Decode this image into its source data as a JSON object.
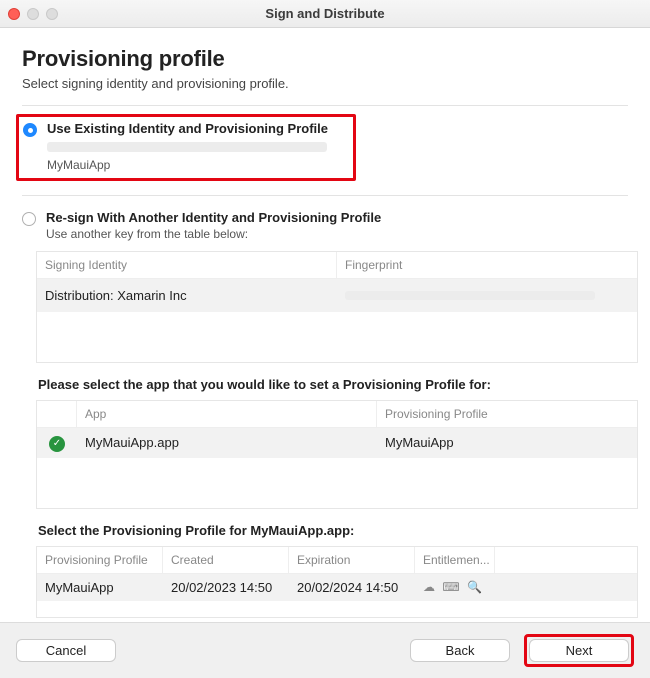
{
  "window": {
    "title": "Sign and Distribute"
  },
  "header": {
    "title": "Provisioning profile",
    "subtitle": "Select signing identity and provisioning profile."
  },
  "option_existing": {
    "title": "Use Existing Identity and Provisioning Profile",
    "profile_name": "MyMauiApp"
  },
  "option_resign": {
    "title": "Re-sign With Another Identity and Provisioning Profile",
    "subtitle": "Use another key from the table below:"
  },
  "signing_table": {
    "headers": {
      "identity": "Signing Identity",
      "fingerprint": "Fingerprint"
    },
    "rows": [
      {
        "identity": "Distribution: Xamarin Inc",
        "fingerprint": ""
      }
    ]
  },
  "app_section": {
    "label": "Please select the app that you would like to set a Provisioning Profile for:",
    "headers": {
      "app": "App",
      "profile": "Provisioning Profile"
    },
    "rows": [
      {
        "app": "MyMauiApp.app",
        "profile": "MyMauiApp",
        "ok": true
      }
    ]
  },
  "profile_section": {
    "label": "Select the Provisioning Profile for MyMauiApp.app:",
    "headers": {
      "profile": "Provisioning Profile",
      "created": "Created",
      "expiration": "Expiration",
      "entitlements": "Entitlemen..."
    },
    "rows": [
      {
        "profile": "MyMauiApp",
        "created": "20/02/2023 14:50",
        "expiration": "20/02/2024 14:50"
      }
    ]
  },
  "footer": {
    "cancel": "Cancel",
    "back": "Back",
    "next": "Next"
  }
}
